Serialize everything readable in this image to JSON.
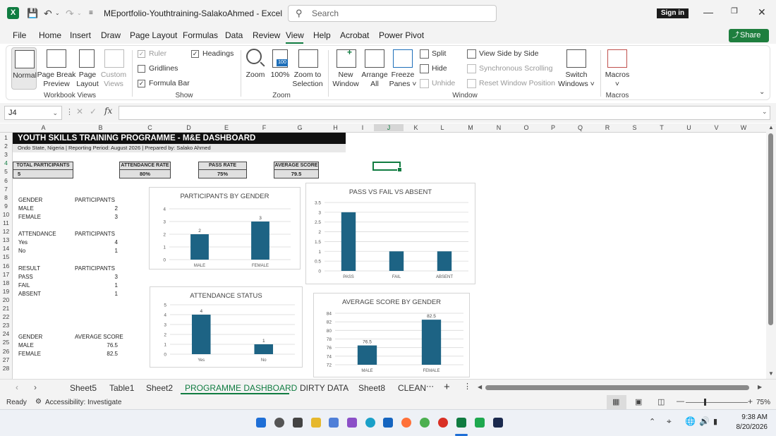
{
  "titlebar": {
    "app_icon": "excel-icon",
    "document_title": "MEportfolio-Youthtraining-SalakoAhmed  -  Excel",
    "search_placeholder": "Search",
    "signin_label": "Sign in"
  },
  "menu": {
    "items": [
      "File",
      "Home",
      "Insert",
      "Draw",
      "Page Layout",
      "Formulas",
      "Data",
      "Review",
      "View",
      "Help",
      "Acrobat",
      "Power Pivot"
    ],
    "active": "View",
    "share_label": "Share"
  },
  "ribbon": {
    "workbook_views": {
      "group_label": "Workbook Views",
      "buttons": [
        {
          "line1": "Normal",
          "line2": ""
        },
        {
          "line1": "Page Break",
          "line2": "Preview"
        },
        {
          "line1": "Page",
          "line2": "Layout"
        },
        {
          "line1": "Custom",
          "line2": "Views"
        }
      ]
    },
    "show": {
      "group_label": "Show",
      "checkboxes": [
        {
          "label": "Ruler",
          "checked": true,
          "disabled": true
        },
        {
          "label": "Gridlines",
          "checked": false,
          "disabled": false
        },
        {
          "label": "Formula Bar",
          "checked": true,
          "disabled": false
        },
        {
          "label": "Headings",
          "checked": true,
          "disabled": false
        }
      ]
    },
    "zoom": {
      "group_label": "Zoom",
      "buttons": [
        {
          "line1": "Zoom",
          "line2": ""
        },
        {
          "line1": "100%",
          "line2": ""
        },
        {
          "line1": "Zoom to",
          "line2": "Selection"
        }
      ]
    },
    "window": {
      "group_label": "Window",
      "big_buttons": [
        {
          "line1": "New",
          "line2": "Window"
        },
        {
          "line1": "Arrange",
          "line2": "All"
        },
        {
          "line1": "Freeze",
          "line2": "Panes ˅"
        }
      ],
      "small_buttons": [
        {
          "label": "Split",
          "disabled": false
        },
        {
          "label": "Hide",
          "disabled": false
        },
        {
          "label": "Unhide",
          "disabled": true
        },
        {
          "label": "View Side by Side",
          "disabled": false
        },
        {
          "label": "Synchronous Scrolling",
          "disabled": true
        },
        {
          "label": "Reset Window Position",
          "disabled": true
        }
      ],
      "switch_windows": {
        "line1": "Switch",
        "line2": "Windows ˅"
      }
    },
    "macros": {
      "group_label": "Macros",
      "button": {
        "line1": "Macros",
        "line2": "˅"
      }
    }
  },
  "formula_bar": {
    "name_box": "J4",
    "fx_label": "fx",
    "formula": ""
  },
  "columns": [
    "A",
    "B",
    "C",
    "D",
    "E",
    "F",
    "G",
    "H",
    "I",
    "J",
    "K",
    "L",
    "M",
    "N",
    "O",
    "P",
    "Q",
    "R",
    "S",
    "T",
    "U",
    "V",
    "W"
  ],
  "rows": [
    "1",
    "2",
    "3",
    "4",
    "5",
    "6",
    "7",
    "8",
    "9",
    "10",
    "11",
    "12",
    "13",
    "14",
    "15",
    "16",
    "17",
    "18",
    "19",
    "20",
    "21",
    "22",
    "23",
    "24",
    "25",
    "26",
    "27",
    "28"
  ],
  "dashboard": {
    "title": "YOUTH SKILLS TRAINING PROGRAMME - M&E DASHBOARD",
    "subtitle": "Ondo State, Nigeria | Reporting Period: August 2026 | Prepared by: Salako Ahmed",
    "kpis": [
      {
        "label": "TOTAL PARTICIPANTS",
        "value": "5"
      },
      {
        "label": "ATTENDANCE RATE",
        "value": "80%"
      },
      {
        "label": "PASS RATE",
        "value": "75%"
      },
      {
        "label": "AVERAGE SCORE",
        "value": "79.5"
      }
    ],
    "tables": {
      "gender": {
        "h1": "GENDER",
        "h2": "PARTICIPANTS",
        "rows": [
          [
            "MALE",
            "2"
          ],
          [
            "FEMALE",
            "3"
          ]
        ]
      },
      "attendance": {
        "h1": "ATTENDANCE",
        "h2": "PARTICIPANTS",
        "rows": [
          [
            "Yes",
            "4"
          ],
          [
            "No",
            "1"
          ]
        ]
      },
      "result": {
        "h1": "RESULT",
        "h2": "PARTICIPANTS",
        "rows": [
          [
            "PASS",
            "3"
          ],
          [
            "FAIL",
            "1"
          ],
          [
            "ABSENT",
            "1"
          ]
        ]
      },
      "score": {
        "h1": "GENDER",
        "h2": "AVERAGE SCORE",
        "rows": [
          [
            "MALE",
            "76.5"
          ],
          [
            "FEMALE",
            "82.5"
          ]
        ]
      }
    }
  },
  "chart_data": [
    {
      "type": "bar",
      "title": "PARTICIPANTS BY GENDER",
      "categories": [
        "MALE",
        "FEMALE"
      ],
      "values": [
        2,
        3
      ],
      "ylim": [
        0,
        4
      ],
      "ticks": [
        0,
        1,
        2,
        3,
        4
      ],
      "color": "#1d6384",
      "grid": true,
      "data_labels": true
    },
    {
      "type": "bar",
      "title": "PASS VS FAIL VS ABSENT",
      "categories": [
        "PASS",
        "FAIL",
        "ABSENT"
      ],
      "values": [
        3,
        1,
        1
      ],
      "ylim": [
        0,
        3.5
      ],
      "ticks": [
        0,
        0.5,
        1,
        1.5,
        2,
        2.5,
        3,
        3.5
      ],
      "color": "#1d6384",
      "grid": true,
      "data_labels": false
    },
    {
      "type": "bar",
      "title": "ATTENDANCE STATUS",
      "categories": [
        "Yes",
        "No"
      ],
      "values": [
        4,
        1
      ],
      "ylim": [
        0,
        5
      ],
      "ticks": [
        0,
        1,
        2,
        3,
        4,
        5
      ],
      "color": "#1d6384",
      "grid": true,
      "data_labels": true
    },
    {
      "type": "bar",
      "title": "AVERAGE SCORE BY GENDER",
      "categories": [
        "MALE",
        "FEMALE"
      ],
      "values": [
        76.5,
        82.5
      ],
      "ylim": [
        72,
        84
      ],
      "ticks": [
        72,
        74,
        76,
        78,
        80,
        82,
        84
      ],
      "color": "#1d6384",
      "grid": true,
      "data_labels": true
    }
  ],
  "sheet_tabs": {
    "tabs": [
      "Sheet5",
      "Table1",
      "Sheet2",
      "PROGRAMME DASHBOARD",
      "DIRTY DATA",
      "Sheet8",
      "CLEAN"
    ],
    "active": "PROGRAMME DASHBOARD"
  },
  "status": {
    "ready": "Ready",
    "accessibility": "Accessibility: Investigate",
    "zoom": "75%"
  },
  "taskbar": {
    "time": "9:38 AM",
    "date": "8/20/2026"
  }
}
